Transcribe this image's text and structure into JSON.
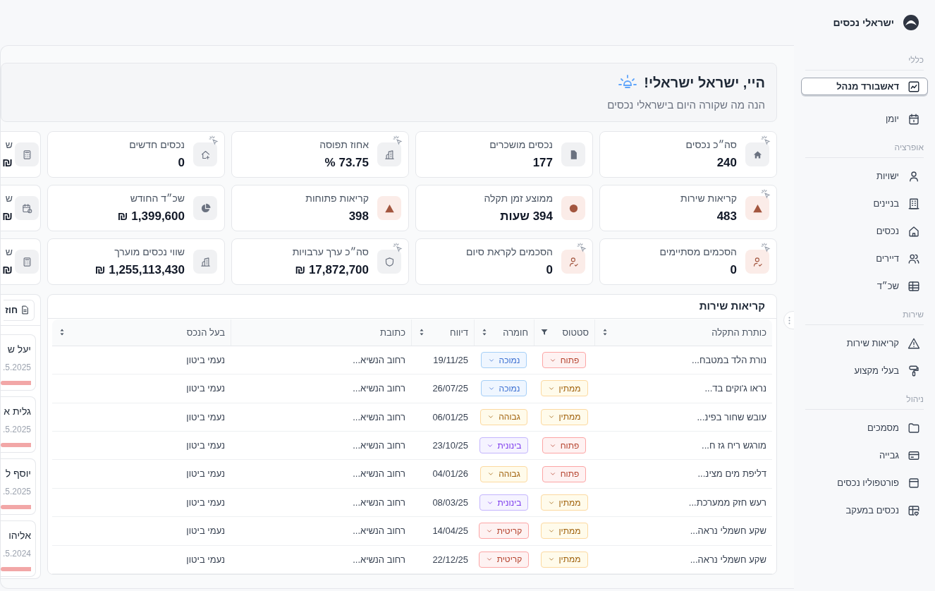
{
  "brand": {
    "name": "ישראלי נכסים"
  },
  "sidebar": {
    "sections": [
      {
        "label": "כללי",
        "items": [
          {
            "label": "דאשבורד מנהל",
            "selected": true
          },
          {
            "label": "יומן",
            "selected": false
          }
        ]
      },
      {
        "label": "אופרציה",
        "items": [
          {
            "label": "ישויות",
            "selected": false
          },
          {
            "label": "בניינים",
            "selected": false
          },
          {
            "label": "נכסים",
            "selected": false
          },
          {
            "label": "דיירים",
            "selected": false
          },
          {
            "label": "שכ״ד",
            "selected": false
          }
        ]
      },
      {
        "label": "שירות",
        "items": [
          {
            "label": "קריאות שירות",
            "selected": false
          },
          {
            "label": "בעלי מקצוע",
            "selected": false
          }
        ]
      },
      {
        "label": "ניהול",
        "items": [
          {
            "label": "מסמכים",
            "selected": false
          },
          {
            "label": "גבייה",
            "selected": false
          },
          {
            "label": "פורטפוליו נכסים",
            "selected": false
          },
          {
            "label": "נכסים במעקב",
            "selected": false
          }
        ]
      }
    ]
  },
  "greeting": {
    "title": "היי, ישראל ישראלי!",
    "subtitle": "הנה מה שקורה היום בישראלי נכסים"
  },
  "stats": [
    {
      "label": "סה״כ נכסים",
      "value": "240",
      "kind": "neutral",
      "sparkle": true
    },
    {
      "label": "נכסים מושכרים",
      "value": "177",
      "kind": "neutral",
      "sparkle": false
    },
    {
      "label": "אחוז תפוסה",
      "value": "73.75 %",
      "kind": "neutral",
      "sparkle": true
    },
    {
      "label": "נכסים חדשים",
      "value": "0",
      "kind": "neutral",
      "sparkle": true
    },
    {
      "label": "ש",
      "value": "₪",
      "kind": "neutral"
    },
    {
      "label": "קריאות שירות",
      "value": "483",
      "kind": "warm",
      "sparkle": true
    },
    {
      "label": "ממוצע זמן תקלה",
      "value": "394 שעות",
      "kind": "warm",
      "sparkle": false
    },
    {
      "label": "קריאות פתוחות",
      "value": "398",
      "kind": "warm",
      "sparkle": false
    },
    {
      "label": "שכ״ד החודש",
      "value": "1,399,600 ₪",
      "kind": "neutral",
      "sparkle": false
    },
    {
      "label": "ש",
      "value": "₪",
      "kind": "neutral"
    },
    {
      "label": "הסכמים מסתיימים",
      "value": "0",
      "kind": "warm",
      "sparkle": true
    },
    {
      "label": "הסכמים לקראת סיום",
      "value": "0",
      "kind": "warm",
      "sparkle": true
    },
    {
      "label": "סה״כ ערך ערבויות",
      "value": "17,872,700 ₪",
      "kind": "neutral",
      "sparkle": true
    },
    {
      "label": "שווי נכסים מוערך",
      "value": "1,255,113,430 ₪",
      "kind": "neutral",
      "sparkle": false
    },
    {
      "label": "ש",
      "value": "₪",
      "kind": "neutral"
    }
  ],
  "service_calls": {
    "title": "קריאות שירות",
    "columns": [
      {
        "label": "כותרת התקלה",
        "sortable": true,
        "filterable": false
      },
      {
        "label": "סטטוס",
        "sortable": false,
        "filterable": true
      },
      {
        "label": "חומרה",
        "sortable": true,
        "filterable": false
      },
      {
        "label": "דיווח",
        "sortable": true,
        "filterable": false
      },
      {
        "label": "כתובת",
        "sortable": false,
        "filterable": false
      },
      {
        "label": "בעל הנכס",
        "sortable": true,
        "filterable": false
      }
    ],
    "rows": [
      {
        "title": "נורת הלד במטבח...",
        "status": {
          "text": "פתוח",
          "kind": "red"
        },
        "severity": {
          "text": "נמוכה",
          "kind": "blue"
        },
        "date": "19/11/25",
        "address": "רחוב הנשיא...",
        "owner": "נעמי ביטון"
      },
      {
        "title": "נראו ג'וקים בד...",
        "status": {
          "text": "ממתין",
          "kind": "amber"
        },
        "severity": {
          "text": "נמוכה",
          "kind": "blue"
        },
        "date": "26/07/25",
        "address": "רחוב הנשיא...",
        "owner": "נעמי ביטון"
      },
      {
        "title": "עובש שחור בפינ...",
        "status": {
          "text": "ממתין",
          "kind": "amber"
        },
        "severity": {
          "text": "גבוהה",
          "kind": "amber"
        },
        "date": "06/01/25",
        "address": "רחוב הנשיא...",
        "owner": "נעמי ביטון"
      },
      {
        "title": "מורגש ריח גז ח...",
        "status": {
          "text": "פתוח",
          "kind": "red"
        },
        "severity": {
          "text": "בינונית",
          "kind": "purple"
        },
        "date": "23/10/25",
        "address": "רחוב הנשיא...",
        "owner": "נעמי ביטון"
      },
      {
        "title": "דליפת מים מצינ...",
        "status": {
          "text": "פתוח",
          "kind": "red"
        },
        "severity": {
          "text": "גבוהה",
          "kind": "amber"
        },
        "date": "04/01/26",
        "address": "רחוב הנשיא...",
        "owner": "נעמי ביטון"
      },
      {
        "title": "רעש חזק ממערכת...",
        "status": {
          "text": "ממתין",
          "kind": "amber"
        },
        "severity": {
          "text": "בינונית",
          "kind": "purple"
        },
        "date": "08/03/25",
        "address": "רחוב הנשיא...",
        "owner": "נעמי ביטון"
      },
      {
        "title": "שקע חשמלי נראה...",
        "status": {
          "text": "ממתין",
          "kind": "amber"
        },
        "severity": {
          "text": "קריטית",
          "kind": "red"
        },
        "date": "14/04/25",
        "address": "רחוב הנשיא...",
        "owner": "נעמי ביטון"
      },
      {
        "title": "שקע חשמלי נראה...",
        "status": {
          "text": "ממתין",
          "kind": "amber"
        },
        "severity": {
          "text": "קריטית",
          "kind": "red"
        },
        "date": "22/12/25",
        "address": "רחוב הנשיא...",
        "owner": "נעמי ביטון"
      }
    ]
  },
  "side_panel": {
    "button": "חוז",
    "items": [
      {
        "name": "יעל ש",
        "date": ".5.2025",
        "level": 1
      },
      {
        "name": "גלית א",
        "date": ".5.2025",
        "level": 1
      },
      {
        "name": "יוסף ל",
        "date": ".5.2025",
        "level": 1
      },
      {
        "name": "אליהו",
        "date": ".5.2024",
        "level": 1
      }
    ]
  }
}
